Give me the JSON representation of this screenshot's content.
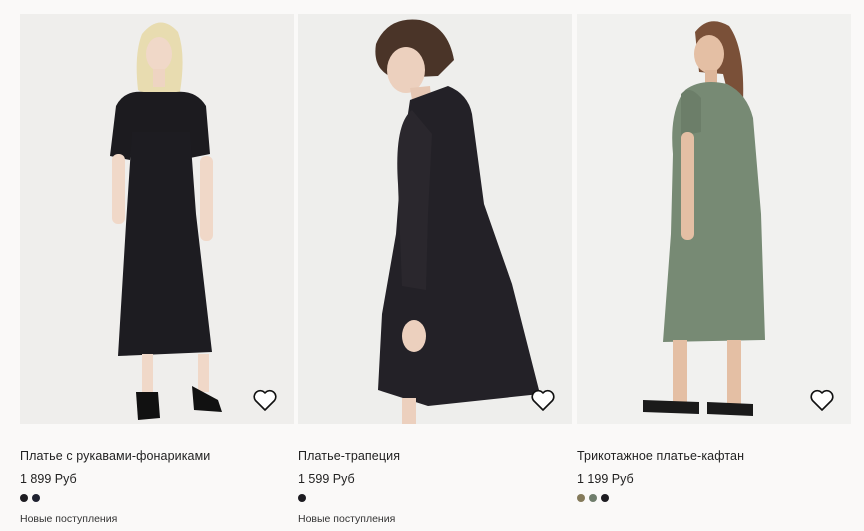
{
  "products": [
    {
      "title": "Платье с рукавами-фонариками",
      "price": "1 899 Руб",
      "swatches": [
        "#1d1c21",
        "#1f2230"
      ],
      "badge": "Новые поступления",
      "favorite_icon": "heart-outline-icon"
    },
    {
      "title": "Платье-трапеция",
      "price": "1 599 Руб",
      "swatches": [
        "#1d1c21"
      ],
      "badge": "Новые поступления",
      "favorite_icon": "heart-outline-icon"
    },
    {
      "title": "Трикотажное платье-кафтан",
      "price": "1 199 Руб",
      "swatches": [
        "#847a5a",
        "#6f7d6c",
        "#1d1c21"
      ],
      "favorite_icon": "heart-outline-icon"
    }
  ],
  "colors": {
    "background": "#faf9f8",
    "photo_background": "#eeeeec",
    "text": "#222222"
  }
}
